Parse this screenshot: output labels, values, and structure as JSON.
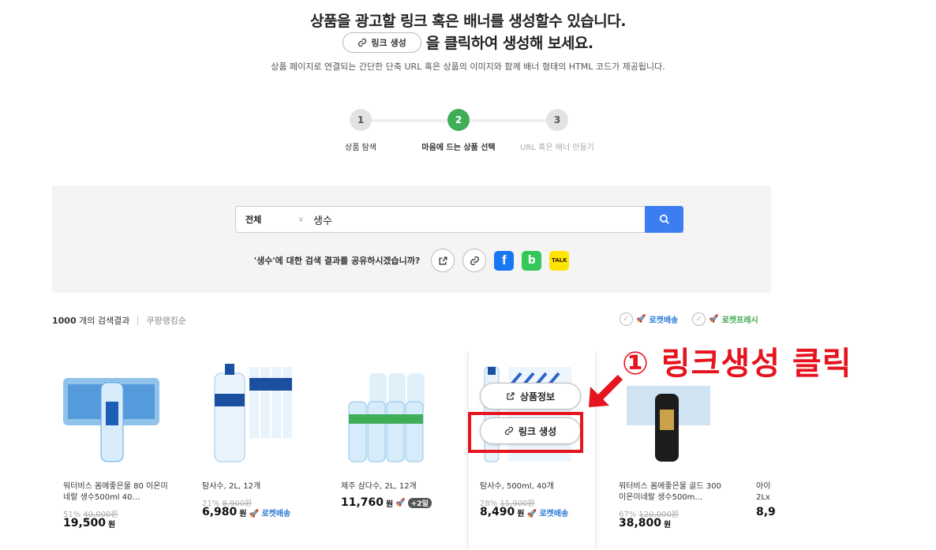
{
  "hero": {
    "title": "상품을 광고할 링크 혹은 배너를 생성할수 있습니다.",
    "inline_button_label": "링크 생성",
    "title_tail": "을 클릭하여 생성해 보세요.",
    "subtitle": "상품 페이지로 연결되는 간단한 단축 URL 혹은 상품의 이미지와 함께 배너 형태의 HTML 코드가 제공됩니다."
  },
  "steps": [
    {
      "number": "1",
      "label": "상품 탐색",
      "state": "done"
    },
    {
      "number": "2",
      "label": "마음에 드는 상품 선택",
      "state": "active"
    },
    {
      "number": "3",
      "label": "URL 혹은 배너 만들기",
      "state": "pending"
    }
  ],
  "search": {
    "category": "전체",
    "query": "생수",
    "share_question": "'생수'에 대한 검색 결과를 공유하시겠습니까?"
  },
  "results": {
    "count_number": "1000",
    "count_suffix": "개의 검색결과",
    "sort": "쿠팡랭킹순",
    "filter_rocket": "로켓배송",
    "filter_fresh": "로켓프레시"
  },
  "products": [
    {
      "name": "워터비스 몸에좋은물 80 이온미네랄 생수500ml 40…",
      "discount": "51%",
      "old_price": "40,000원",
      "price": "19,500",
      "unit": "원",
      "rocket": ""
    },
    {
      "name": "탐사수, 2L, 12개",
      "discount": "21%",
      "old_price": "8,900원",
      "price": "6,980",
      "unit": "원",
      "rocket": "로켓배송"
    },
    {
      "name": "제주 삼다수, 2L, 12개",
      "discount": "",
      "old_price": "",
      "price": "11,760",
      "unit": "원",
      "rocket": "+2일"
    },
    {
      "name": "탐사수, 500ml, 40개",
      "discount": "28%",
      "old_price": "11,900원",
      "price": "8,490",
      "unit": "원",
      "rocket": "로켓배송"
    },
    {
      "name": "워터비스 몸에좋은물 골드 300 이온미네랄 생수500m…",
      "discount": "67%",
      "old_price": "120,000원",
      "price": "38,800",
      "unit": "원",
      "rocket": ""
    },
    {
      "name": "아이 2Lx",
      "discount": "",
      "old_price": "",
      "price": "8,9",
      "unit": "",
      "rocket": ""
    }
  ],
  "hover_actions": {
    "info_label": "상품정보",
    "link_label": "링크 생성"
  },
  "annotation": {
    "text": "① 링크생성 클릭",
    "color": "#e6141e"
  },
  "colors": {
    "step_active": "#3fae59",
    "search_button": "#3c7ef2",
    "rocket_blue": "#2b79d6"
  }
}
